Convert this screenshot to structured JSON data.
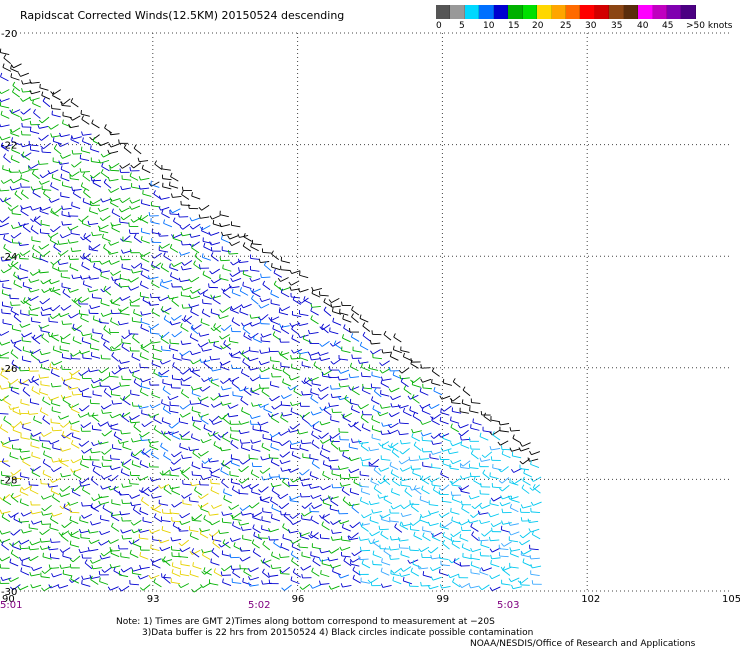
{
  "title": "Rapidscat Corrected Winds(12.5KM) 20150524 descending",
  "legend": {
    "colors": [
      "#555555",
      "#999999",
      "#00d8ff",
      "#0070ff",
      "#0000d0",
      "#00b000",
      "#00e000",
      "#ffd700",
      "#ffa500",
      "#ff6a00",
      "#ff0000",
      "#d20000",
      "#8b4513",
      "#5a2d0c",
      "#ff00ff",
      "#c000c0",
      "#8000b0",
      "#4b0082"
    ],
    "labels": [
      "0",
      "5",
      "10",
      "15",
      "20",
      "25",
      "30",
      "35",
      "40",
      "45",
      ">50 knots"
    ]
  },
  "map": {
    "lon_range": [
      90,
      105
    ],
    "lat_range": [
      -20,
      -30
    ],
    "lon_ticks": [
      "93",
      "96",
      "99",
      "102",
      "105"
    ],
    "lat_ticks": [
      "-20",
      "-22",
      "-24",
      "-26",
      "-28",
      "-30"
    ],
    "lon_origin_label": "90",
    "time_labels": [
      "5:01",
      "5:02",
      "5:03"
    ]
  },
  "notes": {
    "line1": "Note: 1) Times are GMT 2)Times along bottom correspond to measurement at −20S",
    "line2": "3)Data buffer is 22 hrs from 20150524 4) Black circles indicate possible contamination",
    "line3": "NOAA/NESDIS/Office of Research and Applications"
  }
}
